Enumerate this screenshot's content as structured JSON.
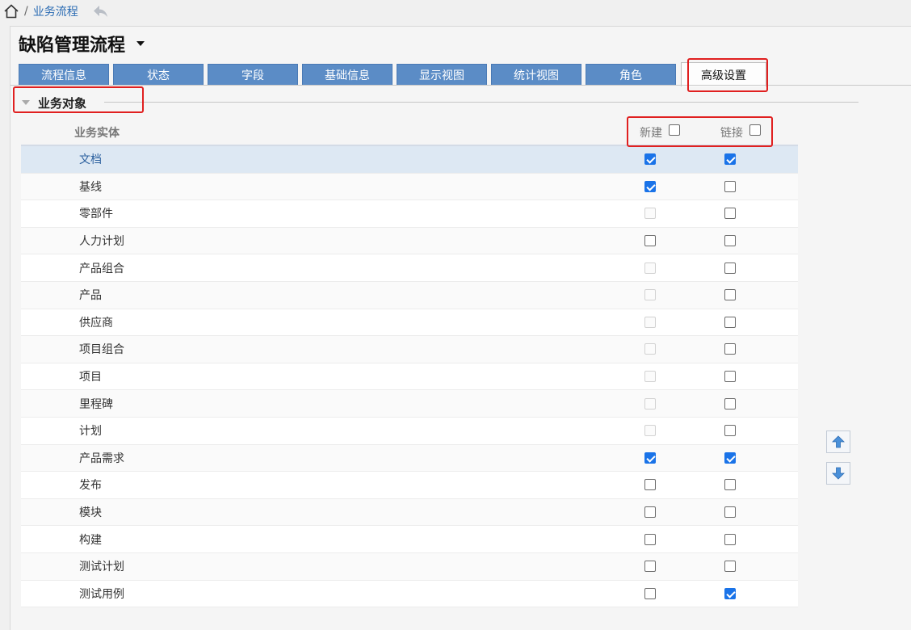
{
  "breadcrumb": {
    "link": "业务流程",
    "separator": "/"
  },
  "page": {
    "title": "缺陷管理流程"
  },
  "tabs": [
    {
      "label": "流程信息",
      "active": false
    },
    {
      "label": "状态",
      "active": false
    },
    {
      "label": "字段",
      "active": false
    },
    {
      "label": "基础信息",
      "active": false
    },
    {
      "label": "显示视图",
      "active": false
    },
    {
      "label": "统计视图",
      "active": false
    },
    {
      "label": "角色",
      "active": false
    },
    {
      "label": "高级设置",
      "active": true
    }
  ],
  "section": {
    "title": "业务对象"
  },
  "table": {
    "headers": {
      "entity": "业务实体",
      "new": "新建",
      "link": "链接"
    },
    "rows": [
      {
        "name": "文档",
        "new": "checked",
        "link": "checked",
        "selected": true
      },
      {
        "name": "基线",
        "new": "checked",
        "link": "unchecked"
      },
      {
        "name": "零部件",
        "new": "disabled",
        "link": "unchecked"
      },
      {
        "name": "人力计划",
        "new": "unchecked",
        "link": "unchecked"
      },
      {
        "name": "产品组合",
        "new": "disabled",
        "link": "unchecked"
      },
      {
        "name": "产品",
        "new": "disabled",
        "link": "unchecked"
      },
      {
        "name": "供应商",
        "new": "disabled",
        "link": "unchecked"
      },
      {
        "name": "项目组合",
        "new": "disabled",
        "link": "unchecked"
      },
      {
        "name": "项目",
        "new": "disabled",
        "link": "unchecked"
      },
      {
        "name": "里程碑",
        "new": "disabled",
        "link": "unchecked"
      },
      {
        "name": "计划",
        "new": "disabled",
        "link": "unchecked"
      },
      {
        "name": "产品需求",
        "new": "checked",
        "link": "checked"
      },
      {
        "name": "发布",
        "new": "unchecked",
        "link": "unchecked"
      },
      {
        "name": "模块",
        "new": "unchecked",
        "link": "unchecked"
      },
      {
        "name": "构建",
        "new": "unchecked",
        "link": "unchecked"
      },
      {
        "name": "测试计划",
        "new": "unchecked",
        "link": "unchecked"
      },
      {
        "name": "测试用例",
        "new": "unchecked",
        "link": "checked"
      }
    ]
  },
  "icons": {
    "home": "home-icon",
    "back": "back-arrow-icon",
    "move_up": "arrow-up-icon",
    "move_down": "arrow-down-icon"
  },
  "colors": {
    "tab": "#5b8cc6",
    "checkbox_checked": "#1a73e8",
    "highlight": "#e02020",
    "selected_row": "#dde8f3"
  }
}
